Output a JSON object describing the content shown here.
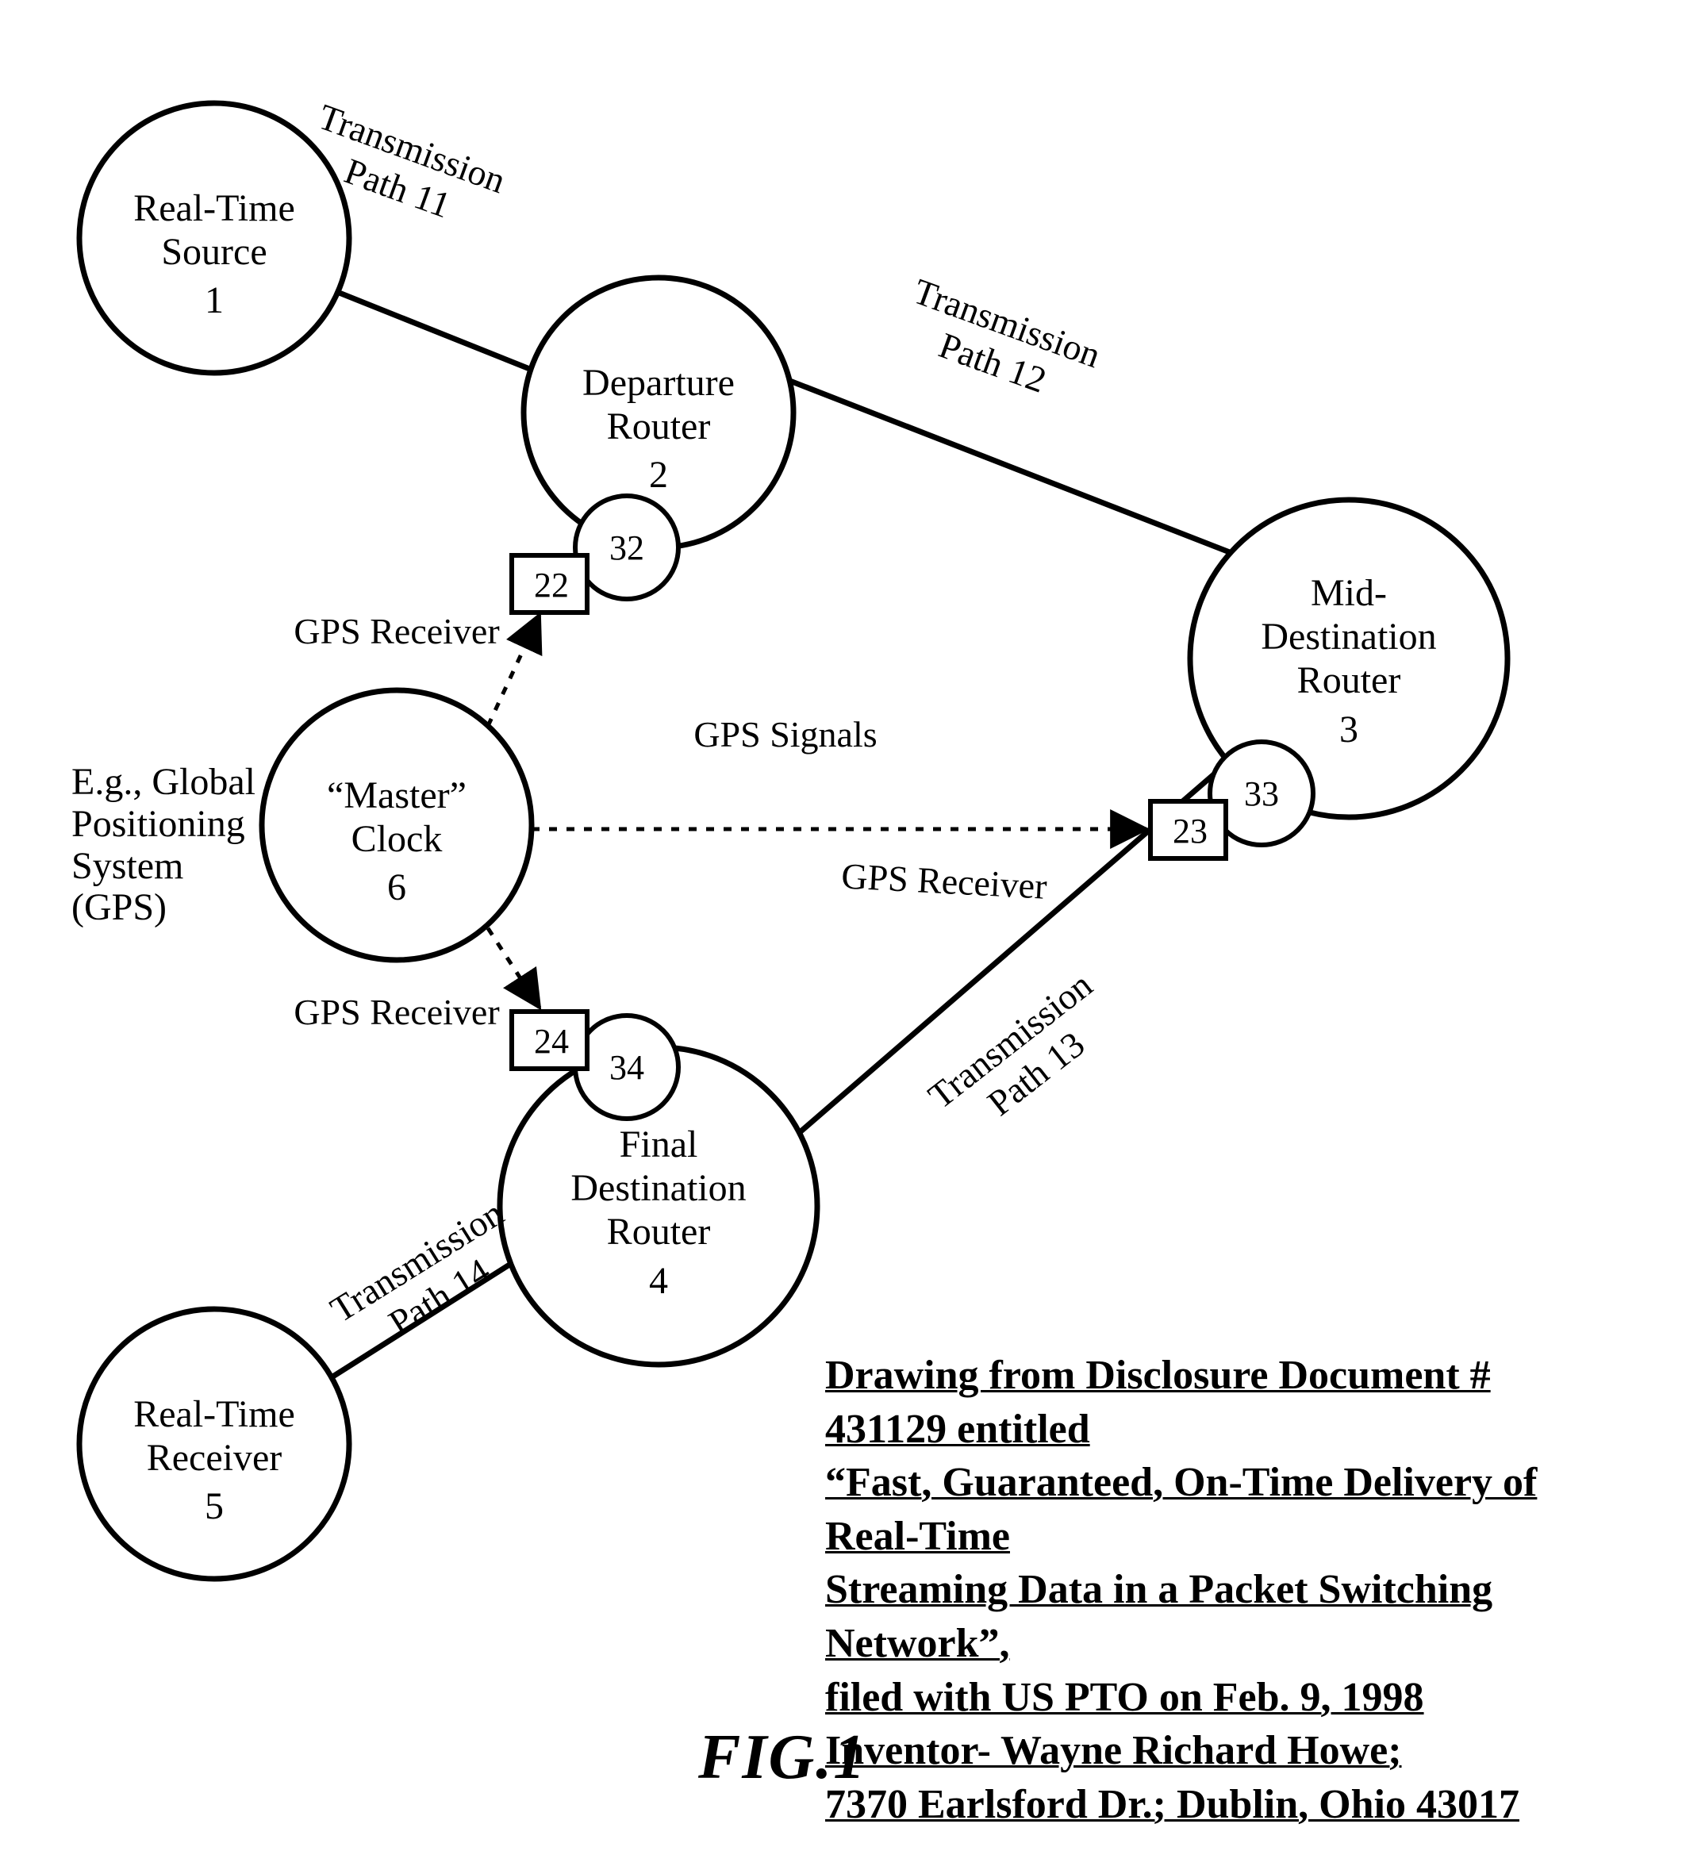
{
  "nodes": {
    "source": {
      "label_l1": "Real-Time",
      "label_l2": "Source",
      "ref": "1"
    },
    "departure": {
      "label_l1": "Departure",
      "label_l2": "Router",
      "ref": "2"
    },
    "mid": {
      "label_l1": "Mid-",
      "label_l2": "Destination",
      "label_l3": "Router",
      "ref": "3"
    },
    "final": {
      "label_l1": "Final",
      "label_l2": "Destination",
      "label_l3": "Router",
      "ref": "4"
    },
    "receiver": {
      "label_l1": "Real-Time",
      "label_l2": "Receiver",
      "ref": "5"
    },
    "master": {
      "label_l1": "“Master”",
      "label_l2": "Clock",
      "ref": "6"
    }
  },
  "receivers": {
    "r22": {
      "box": "22",
      "circle": "32",
      "label": "GPS Receiver"
    },
    "r23": {
      "box": "23",
      "circle": "33",
      "label": "GPS Receiver"
    },
    "r24": {
      "box": "24",
      "circle": "34",
      "label": "GPS Receiver"
    }
  },
  "edges": {
    "p11": {
      "l1": "Transmission",
      "l2": "Path  11"
    },
    "p12": {
      "l1": "Transmission",
      "l2": "Path  12"
    },
    "p13": {
      "l1": "Transmission",
      "l2": "Path  13"
    },
    "p14": {
      "l1": "Transmission",
      "l2": "Path  14"
    },
    "signals": "GPS Signals"
  },
  "gps_note": {
    "l1": "E.g., Global",
    "l2": "Positioning",
    "l3": "System (GPS)"
  },
  "caption": {
    "l1": "Drawing from Disclosure Document # 431129 entitled",
    "l2": "“Fast, Guaranteed, On-Time Delivery of Real-Time",
    "l3": "Streaming Data in a Packet Switching Network”,",
    "l4": "filed with US PTO on Feb. 9, 1998",
    "l5": "Inventor- Wayne Richard Howe;",
    "l6": "7370 Earlsford Dr.; Dublin, Ohio 43017"
  },
  "figure_label": "FIG.1"
}
